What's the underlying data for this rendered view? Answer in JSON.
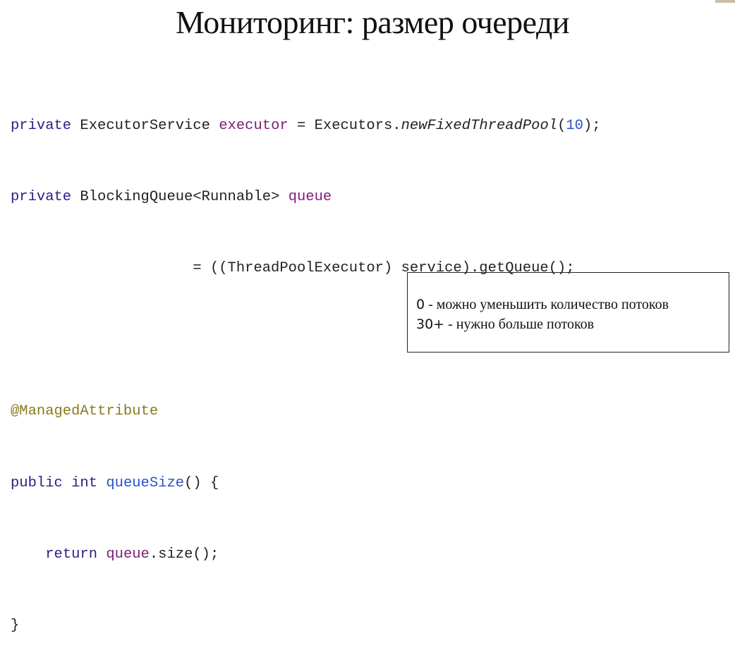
{
  "slide": {
    "title": "Мониторинг: размер очереди"
  },
  "code": {
    "l1": {
      "kw": "private",
      "type": " ExecutorService ",
      "field": "executor",
      "eq": " = Executors.",
      "method": "newFixedThreadPool",
      "open": "(",
      "num": "10",
      "close": ");"
    },
    "l2": {
      "kw": "private",
      "type": " BlockingQueue<Runnable> ",
      "field": "queue"
    },
    "l3": {
      "text": "                     = ((ThreadPoolExecutor) service).getQueue();"
    },
    "l5": {
      "anno": "@ManagedAttribute"
    },
    "l6": {
      "kw1": "public",
      "sp": " ",
      "kw2": "int",
      "sp2": " ",
      "method": "queueSize",
      "rest": "() {"
    },
    "l7": {
      "indent": "    ",
      "kw": "return",
      "sp": " ",
      "field": "queue",
      "rest": ".size();"
    },
    "l8": {
      "text": "}"
    }
  },
  "note": {
    "line1_key": "0",
    "line1_text": " - можно уменьшить количество потоков",
    "line2_key": "30+",
    "line2_text": " - нужно больше потоков"
  }
}
